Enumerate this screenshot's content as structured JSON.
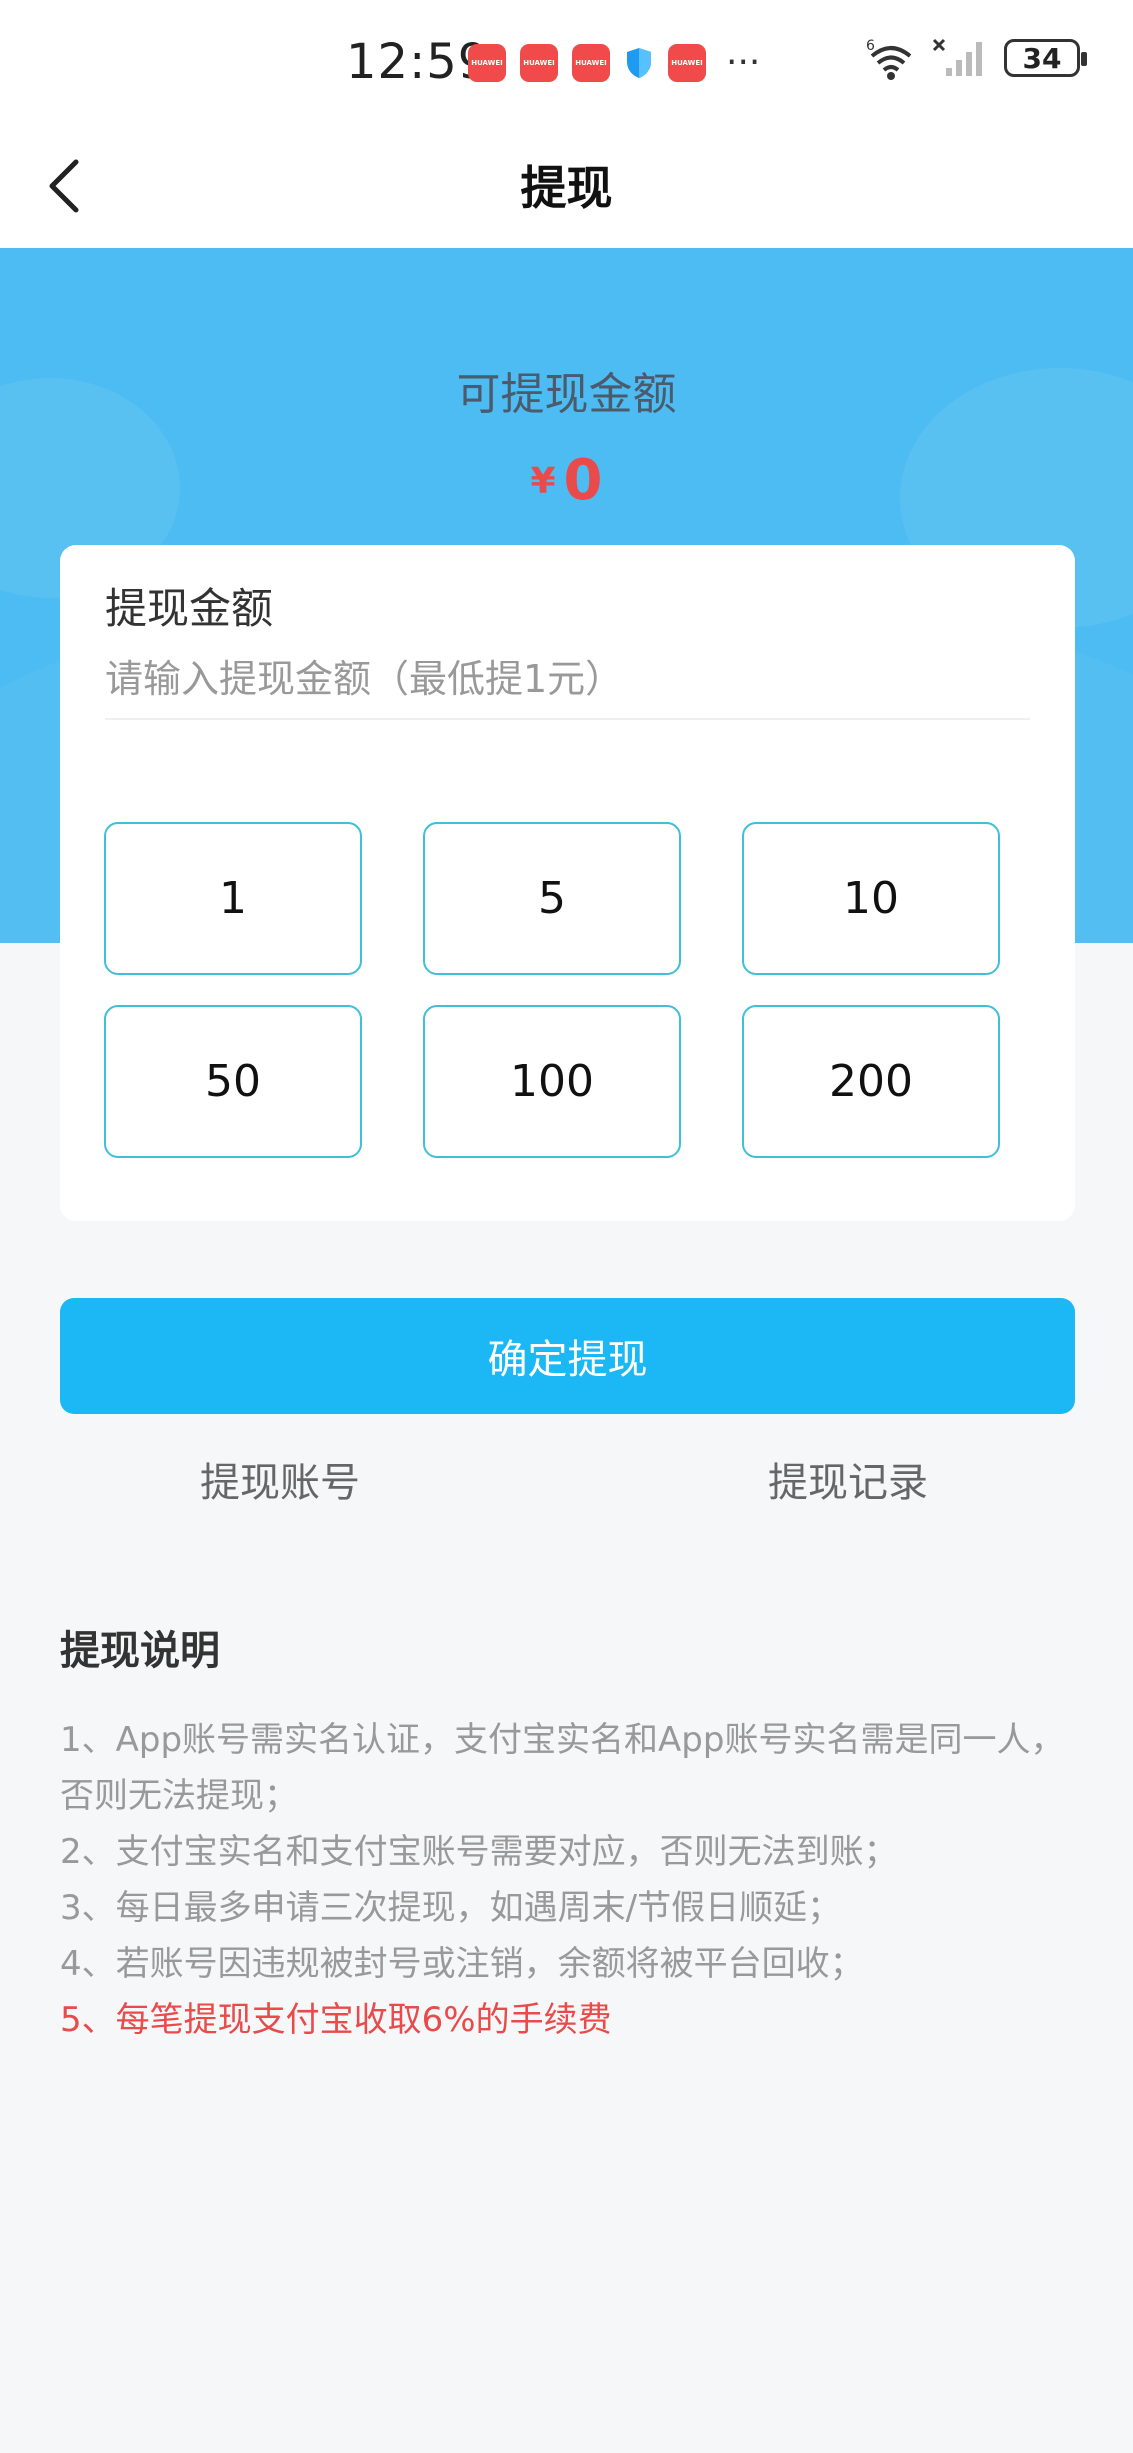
{
  "status_bar": {
    "time": "12:59",
    "badge_text": "HUAWEI",
    "more": "···",
    "network": "6",
    "battery": "34"
  },
  "nav": {
    "title": "提现"
  },
  "hero": {
    "label": "可提现金额",
    "currency": "¥",
    "amount": "0"
  },
  "form": {
    "title": "提现金额",
    "placeholder": "请输入提现金额（最低提1元）",
    "options": [
      "1",
      "5",
      "10",
      "50",
      "100",
      "200"
    ]
  },
  "actions": {
    "confirm": "确定提现",
    "account_link": "提现账号",
    "records_link": "提现记录"
  },
  "notes": {
    "title": "提现说明",
    "items": [
      "1、App账号需实名认证，支付宝实名和App账号实名需是同一人，否则无法提现；",
      "2、支付宝实名和支付宝账号需要对应，否则无法到账；",
      "3、每日最多申请三次提现，如遇周末/节假日顺延；",
      "4、若账号因违规被封号或注销，余额将被平台回收；",
      "5、每笔提现支付宝收取6%的手续费"
    ]
  },
  "colors": {
    "hero_bg": "#4dbcf2",
    "primary": "#1bb8f5",
    "option_border": "#3ec0d9",
    "amount_red": "#e94a4a"
  }
}
